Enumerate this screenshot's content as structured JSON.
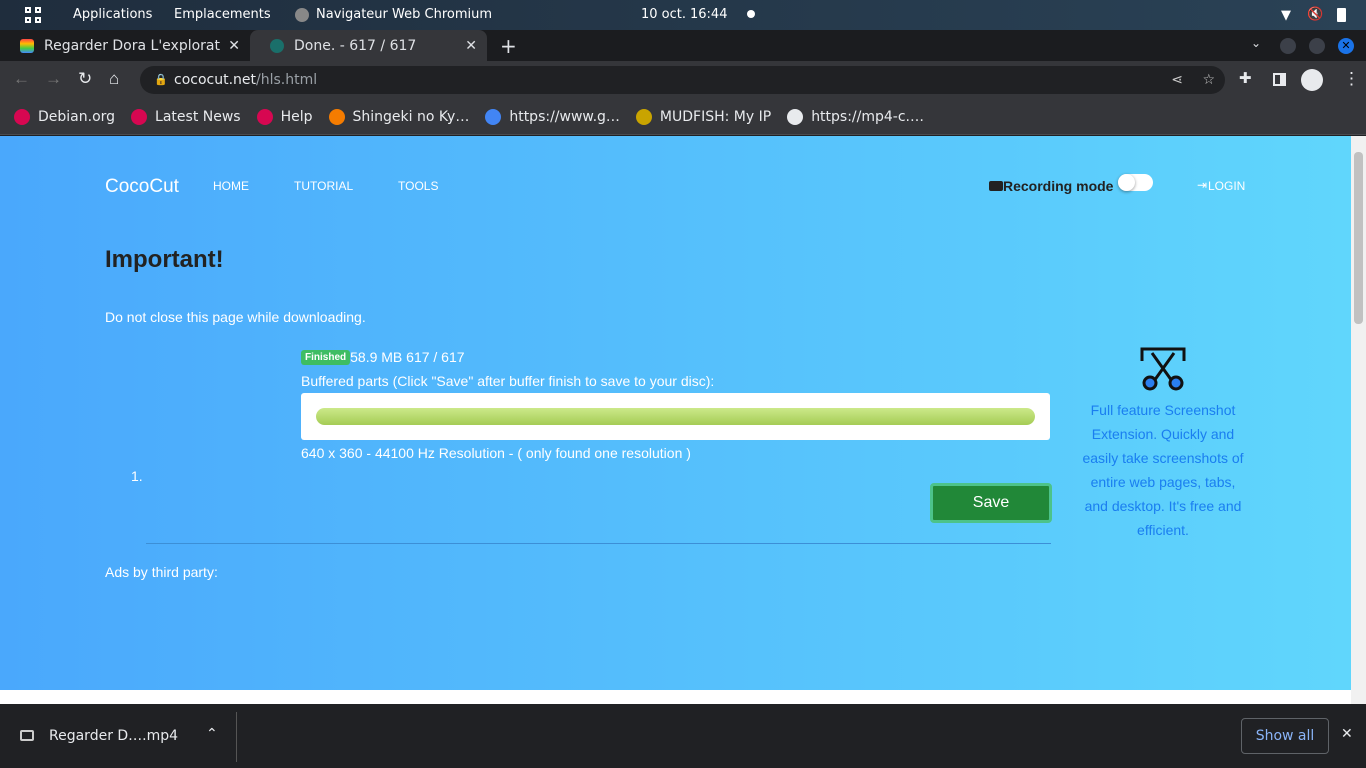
{
  "system": {
    "applications": "Applications",
    "places": "Emplacements",
    "active_app": "Navigateur Web Chromium",
    "date": "10 oct.",
    "time": "16:44"
  },
  "tabs": [
    {
      "title": "Regarder Dora L'explorat"
    },
    {
      "title": "Done. - 617 / 617"
    }
  ],
  "url": {
    "host": "cococut.net",
    "path": "/hls.html"
  },
  "bookmarks": [
    {
      "label": "Debian.org",
      "color": "#d70751"
    },
    {
      "label": "Latest News",
      "color": "#d70751"
    },
    {
      "label": "Help",
      "color": "#d70751"
    },
    {
      "label": "Shingeki no Ky…",
      "color": "#f57c00"
    },
    {
      "label": "https://www.g…",
      "color": "#4285f4"
    },
    {
      "label": "MUDFISH: My IP",
      "color": "#c9a400"
    },
    {
      "label": "https://mp4-c.…",
      "color": "#e8eaed"
    }
  ],
  "site": {
    "brand": "CocoCut",
    "nav": [
      "HOME",
      "TUTORIAL",
      "TOOLS"
    ],
    "recording_label": "Recording mode",
    "recording_on": false,
    "login": "LOGIN"
  },
  "main": {
    "heading": "Important!",
    "notice": "Do not close this page while downloading.",
    "list_number": "1.",
    "status_badge": "Finished",
    "size_info": "58.9 MB 617 / 617",
    "buffer_label": "Buffered parts (Click \"Save\" after buffer finish to save to your disc):",
    "progress": 1.0,
    "resolution": "640 x 360 - 44100 Hz Resolution - ( only found one resolution )",
    "save": "Save",
    "ads_label": "Ads by third party:"
  },
  "ad": {
    "text": "Full feature Screenshot Extension. Quickly and easily take screenshots of entire web pages, tabs, and desktop. It's free and efficient."
  },
  "download": {
    "file": "Regarder D….mp4",
    "show_all": "Show all"
  }
}
